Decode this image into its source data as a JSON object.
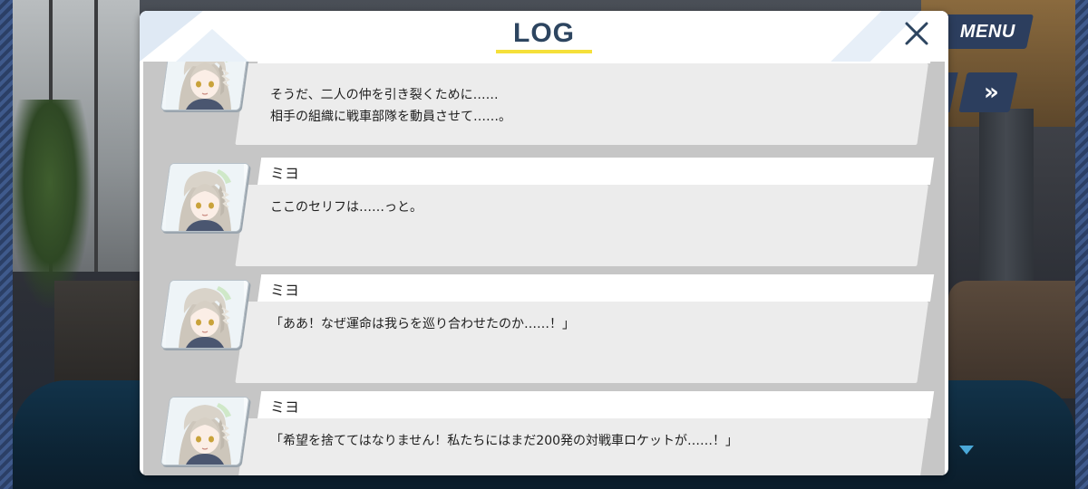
{
  "window": {
    "title": "LOG"
  },
  "controls": {
    "menu_label": "MENU",
    "skip_label": "»"
  },
  "entries": [
    {
      "speaker": "",
      "lines": [
        "そうだ、二人の仲を引き裂くために……",
        "相手の組織に戦車部隊を動員させて……。"
      ]
    },
    {
      "speaker": "ミヨ",
      "lines": [
        "ここのセリフは……っと。"
      ]
    },
    {
      "speaker": "ミヨ",
      "lines": [
        "「ああ！なぜ運命は我らを巡り合わせたのか……！」"
      ]
    },
    {
      "speaker": "ミヨ",
      "lines": [
        "「希望を捨ててはなりません！私たちにはまだ200発の対戦車ロケットが……！」"
      ]
    }
  ],
  "colors": {
    "title": "#2d4560",
    "accent_underline": "#f5e03a",
    "button_bg": "#2c3e5e",
    "next_arrow": "#4aa8d8"
  },
  "icons": {
    "close": "close-icon",
    "skip": "fast-forward-icon",
    "next": "triangle-down-icon"
  }
}
